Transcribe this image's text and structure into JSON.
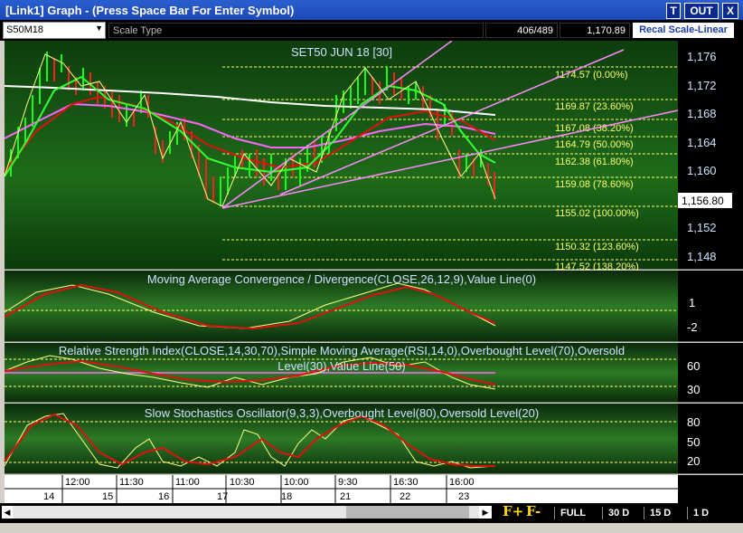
{
  "window": {
    "title": "[Link1] Graph  - (Press Space Bar For Enter Symbol)",
    "btn_t": "T",
    "btn_out": "OUT",
    "btn_x": "X"
  },
  "toolbar": {
    "symbol": "S50M18",
    "scale_type": "Scale Type",
    "bar_count": "406/489",
    "last_value": "1,170.89",
    "recal": "Recal Scale-Linear"
  },
  "main": {
    "title": "SET50 JUN 18   [30]",
    "price_ticks": [
      "1,176",
      "1,172",
      "1,168",
      "1,164",
      "1,160",
      "1,156.80",
      "1,152",
      "1,148"
    ],
    "fib_levels": [
      "1174.57 (0.00%)",
      "1169.87 (23.60%)",
      "1167.08 (38.20%)",
      "1164.79 (50.00%)",
      "1162.38 (61.80%)",
      "1159.08 (78.60%)",
      "1155.02 (100.00%)",
      "1150.32 (123.60%)",
      "1147.52 (138.20%)"
    ]
  },
  "macd": {
    "label": "Moving Average Convergence / Divergence(CLOSE,26,12,9),Value Line(0)",
    "ticks": [
      "1",
      "-2"
    ]
  },
  "rsi": {
    "label1": "Relative Strength Index(CLOSE,14,30,70),Simple Moving Average(RSI,14,0),Overbought Level(70),Oversold",
    "label2": "Level(30),Value Line(50)",
    "ticks": [
      "60",
      "30"
    ]
  },
  "stoch": {
    "label": "Slow Stochastics Oscillator(9,3,3),Overbought Level(80),Oversold Level(20)",
    "ticks": [
      "80",
      "50",
      "20"
    ]
  },
  "time_axis": {
    "times": [
      "12:00",
      "11:30",
      "11:00",
      "10:30",
      "10:00",
      "9:30",
      "16:30",
      "16:00"
    ],
    "days": [
      "14",
      "15",
      "16",
      "17",
      "18",
      "21",
      "22",
      "23"
    ]
  },
  "bottom": {
    "f_plus": "F+",
    "f_minus": "F-",
    "periods": [
      "FULL",
      "30 D",
      "15 D",
      "1 D"
    ]
  },
  "colors": {
    "panel_bg": "#0a3a0a",
    "price_axis_text": "#cfe2ff",
    "fib_text": "#ffff66",
    "macd_line": "#e01010",
    "fast_line": "#ffff80",
    "white_ma": "#ffffff",
    "green_ma": "#33ff33",
    "magenta_ma": "#ff66ff",
    "trendline": "#ff88ff"
  }
}
